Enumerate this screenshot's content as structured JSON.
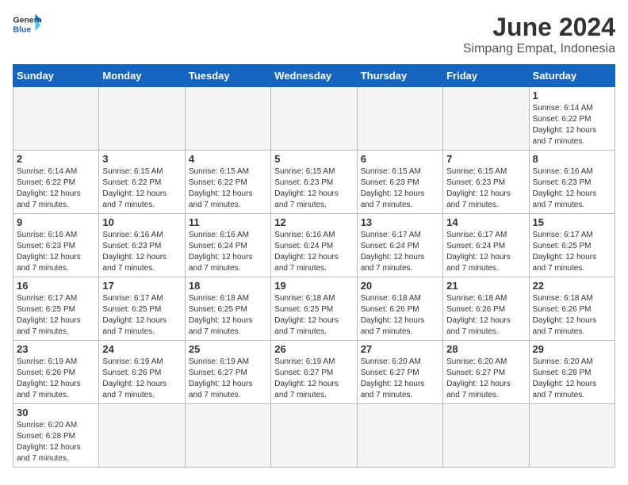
{
  "header": {
    "logo_general": "General",
    "logo_blue": "Blue",
    "month_title": "June 2024",
    "location": "Simpang Empat, Indonesia"
  },
  "weekdays": [
    "Sunday",
    "Monday",
    "Tuesday",
    "Wednesday",
    "Thursday",
    "Friday",
    "Saturday"
  ],
  "days": {
    "d1": {
      "num": "1",
      "sunrise": "6:14 AM",
      "sunset": "6:22 PM",
      "daylight": "12 hours and 7 minutes."
    },
    "d2": {
      "num": "2",
      "sunrise": "6:14 AM",
      "sunset": "6:22 PM",
      "daylight": "12 hours and 7 minutes."
    },
    "d3": {
      "num": "3",
      "sunrise": "6:15 AM",
      "sunset": "6:22 PM",
      "daylight": "12 hours and 7 minutes."
    },
    "d4": {
      "num": "4",
      "sunrise": "6:15 AM",
      "sunset": "6:22 PM",
      "daylight": "12 hours and 7 minutes."
    },
    "d5": {
      "num": "5",
      "sunrise": "6:15 AM",
      "sunset": "6:23 PM",
      "daylight": "12 hours and 7 minutes."
    },
    "d6": {
      "num": "6",
      "sunrise": "6:15 AM",
      "sunset": "6:23 PM",
      "daylight": "12 hours and 7 minutes."
    },
    "d7": {
      "num": "7",
      "sunrise": "6:15 AM",
      "sunset": "6:23 PM",
      "daylight": "12 hours and 7 minutes."
    },
    "d8": {
      "num": "8",
      "sunrise": "6:16 AM",
      "sunset": "6:23 PM",
      "daylight": "12 hours and 7 minutes."
    },
    "d9": {
      "num": "9",
      "sunrise": "6:16 AM",
      "sunset": "6:23 PM",
      "daylight": "12 hours and 7 minutes."
    },
    "d10": {
      "num": "10",
      "sunrise": "6:16 AM",
      "sunset": "6:23 PM",
      "daylight": "12 hours and 7 minutes."
    },
    "d11": {
      "num": "11",
      "sunrise": "6:16 AM",
      "sunset": "6:24 PM",
      "daylight": "12 hours and 7 minutes."
    },
    "d12": {
      "num": "12",
      "sunrise": "6:16 AM",
      "sunset": "6:24 PM",
      "daylight": "12 hours and 7 minutes."
    },
    "d13": {
      "num": "13",
      "sunrise": "6:17 AM",
      "sunset": "6:24 PM",
      "daylight": "12 hours and 7 minutes."
    },
    "d14": {
      "num": "14",
      "sunrise": "6:17 AM",
      "sunset": "6:24 PM",
      "daylight": "12 hours and 7 minutes."
    },
    "d15": {
      "num": "15",
      "sunrise": "6:17 AM",
      "sunset": "6:25 PM",
      "daylight": "12 hours and 7 minutes."
    },
    "d16": {
      "num": "16",
      "sunrise": "6:17 AM",
      "sunset": "6:25 PM",
      "daylight": "12 hours and 7 minutes."
    },
    "d17": {
      "num": "17",
      "sunrise": "6:17 AM",
      "sunset": "6:25 PM",
      "daylight": "12 hours and 7 minutes."
    },
    "d18": {
      "num": "18",
      "sunrise": "6:18 AM",
      "sunset": "6:25 PM",
      "daylight": "12 hours and 7 minutes."
    },
    "d19": {
      "num": "19",
      "sunrise": "6:18 AM",
      "sunset": "6:25 PM",
      "daylight": "12 hours and 7 minutes."
    },
    "d20": {
      "num": "20",
      "sunrise": "6:18 AM",
      "sunset": "6:26 PM",
      "daylight": "12 hours and 7 minutes."
    },
    "d21": {
      "num": "21",
      "sunrise": "6:18 AM",
      "sunset": "6:26 PM",
      "daylight": "12 hours and 7 minutes."
    },
    "d22": {
      "num": "22",
      "sunrise": "6:18 AM",
      "sunset": "6:26 PM",
      "daylight": "12 hours and 7 minutes."
    },
    "d23": {
      "num": "23",
      "sunrise": "6:19 AM",
      "sunset": "6:26 PM",
      "daylight": "12 hours and 7 minutes."
    },
    "d24": {
      "num": "24",
      "sunrise": "6:19 AM",
      "sunset": "6:26 PM",
      "daylight": "12 hours and 7 minutes."
    },
    "d25": {
      "num": "25",
      "sunrise": "6:19 AM",
      "sunset": "6:27 PM",
      "daylight": "12 hours and 7 minutes."
    },
    "d26": {
      "num": "26",
      "sunrise": "6:19 AM",
      "sunset": "6:27 PM",
      "daylight": "12 hours and 7 minutes."
    },
    "d27": {
      "num": "27",
      "sunrise": "6:20 AM",
      "sunset": "6:27 PM",
      "daylight": "12 hours and 7 minutes."
    },
    "d28": {
      "num": "28",
      "sunrise": "6:20 AM",
      "sunset": "6:27 PM",
      "daylight": "12 hours and 7 minutes."
    },
    "d29": {
      "num": "29",
      "sunrise": "6:20 AM",
      "sunset": "6:28 PM",
      "daylight": "12 hours and 7 minutes."
    },
    "d30": {
      "num": "30",
      "sunrise": "6:20 AM",
      "sunset": "6:28 PM",
      "daylight": "12 hours and 7 minutes."
    }
  }
}
